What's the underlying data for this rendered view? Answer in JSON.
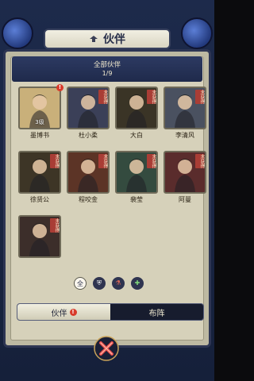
{
  "title": "伙伴",
  "header": {
    "section_title": "全部伙伴",
    "count": "1/9"
  },
  "partners": [
    {
      "name": "墨博书",
      "level": "3级",
      "locked": false,
      "has_alert": true,
      "color": "#c9b07a"
    },
    {
      "name": "杜小柔",
      "locked": true,
      "lock_label": "未获得",
      "color": "#3b4058"
    },
    {
      "name": "大白",
      "locked": true,
      "lock_label": "未获得",
      "color": "#3a3426"
    },
    {
      "name": "李清风",
      "locked": true,
      "lock_label": "未获得",
      "color": "#4a5160"
    },
    {
      "name": "徐贤公",
      "locked": true,
      "lock_label": "未获得",
      "color": "#3d3526"
    },
    {
      "name": "程咬金",
      "locked": true,
      "lock_label": "未获得",
      "color": "#5c3426"
    },
    {
      "name": "裴莹",
      "locked": true,
      "lock_label": "未获得",
      "color": "#344b3f"
    },
    {
      "name": "阿曼",
      "locked": true,
      "lock_label": "未获得",
      "color": "#5a2c2c"
    },
    {
      "name": "",
      "locked": true,
      "lock_label": "未获得",
      "color": "#3c2e2a"
    }
  ],
  "filters": [
    {
      "label": "全",
      "active": true,
      "icon": "all-icon"
    },
    {
      "label": "",
      "active": false,
      "icon": "shield-icon"
    },
    {
      "label": "",
      "active": false,
      "icon": "potion-icon"
    },
    {
      "label": "",
      "active": false,
      "icon": "plus-icon"
    }
  ],
  "tabs": [
    {
      "label": "伙伴",
      "active": true,
      "alert": "!"
    },
    {
      "label": "布阵",
      "active": false
    }
  ],
  "alert_mark": "!"
}
